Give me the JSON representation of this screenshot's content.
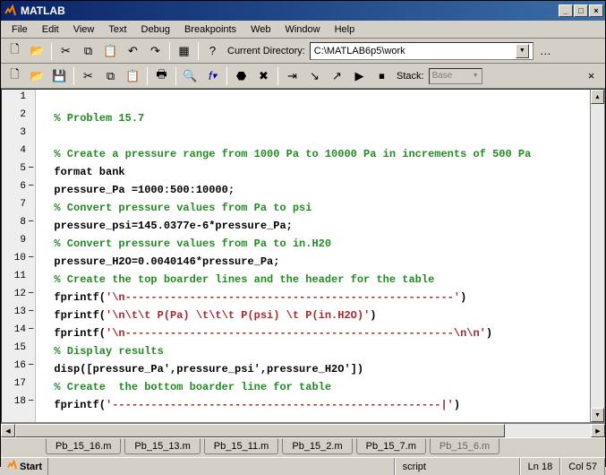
{
  "title": "MATLAB",
  "menubar": [
    "File",
    "Edit",
    "View",
    "Text",
    "Debug",
    "Breakpoints",
    "Web",
    "Window",
    "Help"
  ],
  "toolbar1": {
    "current_dir_label": "Current Directory:",
    "current_dir_value": "C:\\MATLAB6p5\\work"
  },
  "toolbar2": {
    "stack_label": "Stack:",
    "stack_value": "Base"
  },
  "code": {
    "lines": [
      {
        "n": 1,
        "dash": false,
        "segs": [
          {
            "t": "",
            "cls": ""
          }
        ]
      },
      {
        "n": 2,
        "dash": false,
        "segs": [
          {
            "t": "  % Problem 15.7",
            "cls": "c-comment"
          }
        ]
      },
      {
        "n": 3,
        "dash": false,
        "segs": [
          {
            "t": "",
            "cls": ""
          }
        ]
      },
      {
        "n": 4,
        "dash": false,
        "segs": [
          {
            "t": "  % Create a pressure range from 1000 Pa to 10000 Pa in increments of 500 Pa",
            "cls": "c-comment"
          }
        ]
      },
      {
        "n": 5,
        "dash": true,
        "segs": [
          {
            "t": "  format bank",
            "cls": "c-code"
          }
        ]
      },
      {
        "n": 6,
        "dash": true,
        "segs": [
          {
            "t": "  pressure_Pa =1000:500:10000;",
            "cls": "c-code"
          }
        ]
      },
      {
        "n": 7,
        "dash": false,
        "segs": [
          {
            "t": "  % Convert pressure values from Pa to psi",
            "cls": "c-comment"
          }
        ]
      },
      {
        "n": 8,
        "dash": true,
        "segs": [
          {
            "t": "  pressure_psi=145.0377e-6*pressure_Pa;",
            "cls": "c-code"
          }
        ]
      },
      {
        "n": 9,
        "dash": false,
        "segs": [
          {
            "t": "  % Convert pressure values from Pa to in.H20",
            "cls": "c-comment"
          }
        ]
      },
      {
        "n": 10,
        "dash": true,
        "segs": [
          {
            "t": "  pressure_H2O=0.0040146*pressure_Pa;",
            "cls": "c-code"
          }
        ]
      },
      {
        "n": 11,
        "dash": false,
        "segs": [
          {
            "t": "  % Create the top boarder lines and the header for the table",
            "cls": "c-comment"
          }
        ]
      },
      {
        "n": 12,
        "dash": true,
        "segs": [
          {
            "t": "  fprintf(",
            "cls": "c-code"
          },
          {
            "t": "'\\n---------------------------------------------------'",
            "cls": "c-string"
          },
          {
            "t": ")",
            "cls": "c-code"
          }
        ]
      },
      {
        "n": 13,
        "dash": true,
        "segs": [
          {
            "t": "  fprintf(",
            "cls": "c-code"
          },
          {
            "t": "'\\n\\t\\t P(Pa) \\t\\t\\t P(psi) \\t P(in.H2O)'",
            "cls": "c-string"
          },
          {
            "t": ")",
            "cls": "c-code"
          }
        ]
      },
      {
        "n": 14,
        "dash": true,
        "segs": [
          {
            "t": "  fprintf(",
            "cls": "c-code"
          },
          {
            "t": "'\\n---------------------------------------------------\\n\\n'",
            "cls": "c-string"
          },
          {
            "t": ")",
            "cls": "c-code"
          }
        ]
      },
      {
        "n": 15,
        "dash": false,
        "segs": [
          {
            "t": "  % Display results",
            "cls": "c-comment"
          }
        ]
      },
      {
        "n": 16,
        "dash": true,
        "segs": [
          {
            "t": "  disp([pressure_Pa',pressure_psi',pressure_H2O'])",
            "cls": "c-code"
          }
        ]
      },
      {
        "n": 17,
        "dash": false,
        "segs": [
          {
            "t": "  % Create  the bottom boarder line for table",
            "cls": "c-comment"
          }
        ]
      },
      {
        "n": 18,
        "dash": true,
        "segs": [
          {
            "t": "  fprintf(",
            "cls": "c-code"
          },
          {
            "t": "'---------------------------------------------------|'",
            "cls": "c-string"
          },
          {
            "t": ")",
            "cls": "c-code"
          }
        ]
      }
    ]
  },
  "tabs": [
    "Pb_15_16.m",
    "Pb_15_13.m",
    "Pb_15_11.m",
    "Pb_15_2.m",
    "Pb_15_7.m",
    "Pb_15_6.m"
  ],
  "active_tab": 5,
  "status": {
    "start": "Start",
    "mode": "script",
    "line": "Ln 18",
    "col": "Col 57"
  }
}
